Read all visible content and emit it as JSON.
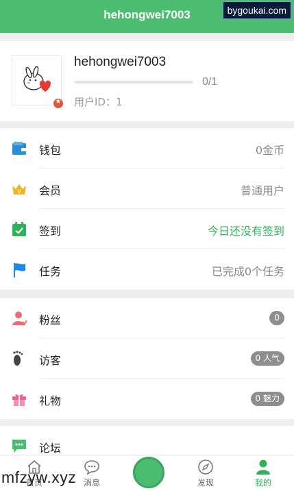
{
  "header": {
    "title": "hehongwei7003",
    "watermark": "bygoukai.com"
  },
  "profile": {
    "username": "hehongwei7003",
    "progress_text": "0/1",
    "progress": 0,
    "user_id": "用户ID：1",
    "badge_color": "#e2553a"
  },
  "section1": [
    {
      "label": "钱包",
      "value": "0金币",
      "icon": "wallet-icon"
    },
    {
      "label": "会员",
      "value": "普通用户",
      "icon": "crown-icon"
    },
    {
      "label": "签到",
      "value": "今日还没有签到",
      "icon": "calendar-check-icon"
    },
    {
      "label": "任务",
      "value": "已完成0个任务",
      "icon": "flag-icon"
    }
  ],
  "section2": [
    {
      "label": "粉丝",
      "pill": "0",
      "icon": "person-icon"
    },
    {
      "label": "访客",
      "pill": "0 人气",
      "icon": "footprint-icon"
    },
    {
      "label": "礼物",
      "pill": "0 魅力",
      "icon": "gift-icon"
    }
  ],
  "section3": [
    {
      "label": "论坛",
      "icon": "chat-icon"
    }
  ],
  "tabs": [
    {
      "label": "首页",
      "icon": "home-icon"
    },
    {
      "label": "消息",
      "icon": "message-icon"
    },
    {
      "label": "发现",
      "icon": "compass-icon"
    },
    {
      "label": "我的",
      "icon": "user-icon"
    }
  ],
  "colors": {
    "brand": "#4cbd70",
    "accent_green": "#2fb158",
    "pill_gray": "#8e8e8e"
  },
  "watermark_bottom": "mfzyw.xyz"
}
